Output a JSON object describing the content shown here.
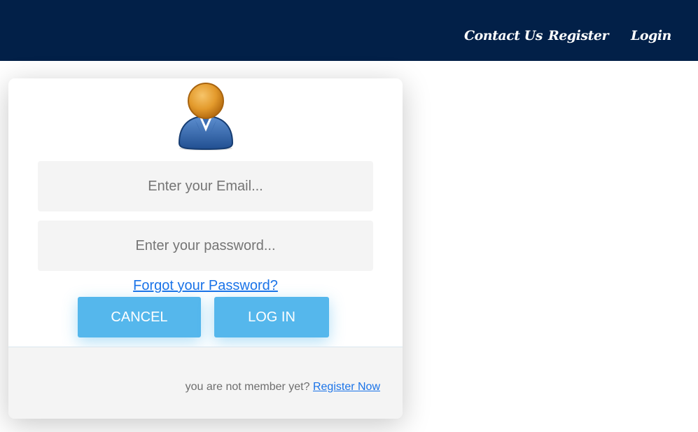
{
  "nav": {
    "contact": "Contact Us",
    "register": "Register",
    "login": "Login"
  },
  "form": {
    "email_placeholder": "Enter your Email...",
    "password_placeholder": "Enter your password...",
    "email_value": "",
    "password_value": "",
    "forgot_link": "Forgot your Password?",
    "cancel_button": "CANCEL",
    "login_button": "LOG IN"
  },
  "footer": {
    "prompt": "you are not member yet?",
    "register_link": "Register Now"
  },
  "colors": {
    "navbar": "#022048",
    "button": "#55b7ec",
    "link": "#1a73e8"
  },
  "icons": {
    "avatar": "user-avatar-icon"
  }
}
